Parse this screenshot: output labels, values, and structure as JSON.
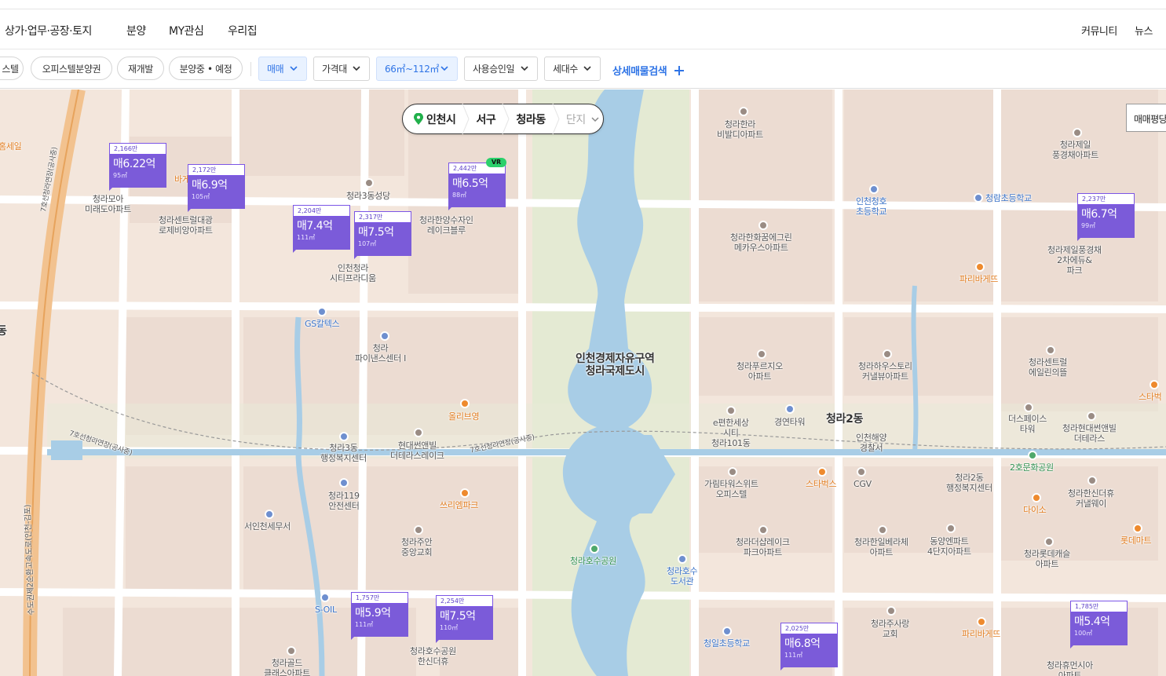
{
  "nav": {
    "items": [
      "상가·업무·공장·토지",
      "분양",
      "MY관심",
      "우리집"
    ],
    "right_items": [
      "커뮤니티",
      "뉴스"
    ]
  },
  "filters": {
    "pills": [
      "스텔",
      "오피스텔분양권",
      "재개발",
      "분양중 • 예정"
    ],
    "dropdowns": [
      {
        "label": "매매",
        "active": true
      },
      {
        "label": "가격대",
        "active": false
      },
      {
        "label": "66㎡~112㎡",
        "active": true
      },
      {
        "label": "사용승인일",
        "active": false
      },
      {
        "label": "세대수",
        "active": false
      }
    ],
    "detail_search": "상세매물검색",
    "colors": {
      "active_text": "#2f74e6",
      "active_bg": "#e9f2ff"
    }
  },
  "breadcrumb": {
    "city": "인천시",
    "district": "서구",
    "dong": "청라동",
    "complex": "단지",
    "pin_icon": "location-pin-icon"
  },
  "sort_button": "매매평당",
  "markers": [
    {
      "unit": "2,166만",
      "price": "매6.22억",
      "area": "95㎡"
    },
    {
      "unit": "2,172만",
      "price": "매6.9억",
      "area": "105㎡"
    },
    {
      "unit": "2,442만",
      "price": "매6.5억",
      "area": "88㎡",
      "badge": "VR"
    },
    {
      "unit": "2,204만",
      "price": "매7.4억",
      "area": "111㎡"
    },
    {
      "unit": "2,317만",
      "price": "매7.5억",
      "area": "107㎡"
    },
    {
      "unit": "2,237만",
      "price": "매6.7억",
      "area": "99㎡"
    },
    {
      "unit": "1,757만",
      "price": "매5.9억",
      "area": "111㎡"
    },
    {
      "unit": "2,254만",
      "price": "매7.5억",
      "area": "110㎡"
    },
    {
      "unit": "2,025만",
      "price": "매6.8억",
      "area": "111㎡"
    },
    {
      "unit": "1,785만",
      "price": "매5.4억",
      "area": "100㎡"
    }
  ],
  "map_labels": {
    "region": "인천경제자유구역\n청라국제도시",
    "cheongna2": "청라2동",
    "west_dong": "동",
    "homesale": "홈세일",
    "bakery_left": "바게",
    "places": [
      "청라한라\n비발디아파트",
      "청라제일\n풍경채아파트",
      "인천청호\n초등학교",
      "청람초등학교",
      "청라한화꿈에그린\n메카우스아파트",
      "청라제일풍경채\n2차에듀&\n파크",
      "파리바게뜨",
      "청라3동성당",
      "청라한양수자인\n레이크블루",
      "청라모아\n미래도아파트",
      "청라센트럴대광\n로제비앙아파트",
      "인천청라\n시티프라디움",
      "GS칼텍스",
      "청라\n파이낸스센터 I",
      "청라푸르지오\n아파트",
      "청라하우스토리\n커낼뷰아파트",
      "청라센트럴\n에일린의뜰",
      "스타벅스",
      "올리브영",
      "e편한세상\n시티\n청라101동",
      "경연타워",
      "인천해양\n경찰서",
      "더스페이스\n타워",
      "청라현대썬앤빌\n더테라스",
      "청라3동\n행정복지센터",
      "현대썬앤빌\n더테라스레이크",
      "청라2동\n행정복지센터",
      "2호문화공원",
      "가림타워스위트\n오피스텔",
      "스타벅스",
      "CGV",
      "청라한신더휴\n커낼웨이",
      "청라119\n안전센터",
      "쓰리엠파크",
      "다이소",
      "서인천세무서",
      "롯데마트",
      "청라주안\n중앙교회",
      "청라더샵레이크\n파크아파트",
      "청라한일베라체\n아파트",
      "동양엔파트\n4단지아파트",
      "청라롯데캐슬\n아파트",
      "청라호수공원",
      "청라호수\n도서관",
      "S-OIL",
      "청라주사랑\n교회",
      "파리바게뜨",
      "청일초등학교",
      "청라호수공원\n한신더휴",
      "청라골드\n클래스아파트",
      "청라휴먼시아\n아파트",
      "스타벅"
    ],
    "roads": [
      "7호선청라연장(공사중)",
      "7호선청라연장(공사중)",
      "7호선청라연장(공사중)",
      "수도권제2순환고속도로(인천-김포)"
    ]
  }
}
